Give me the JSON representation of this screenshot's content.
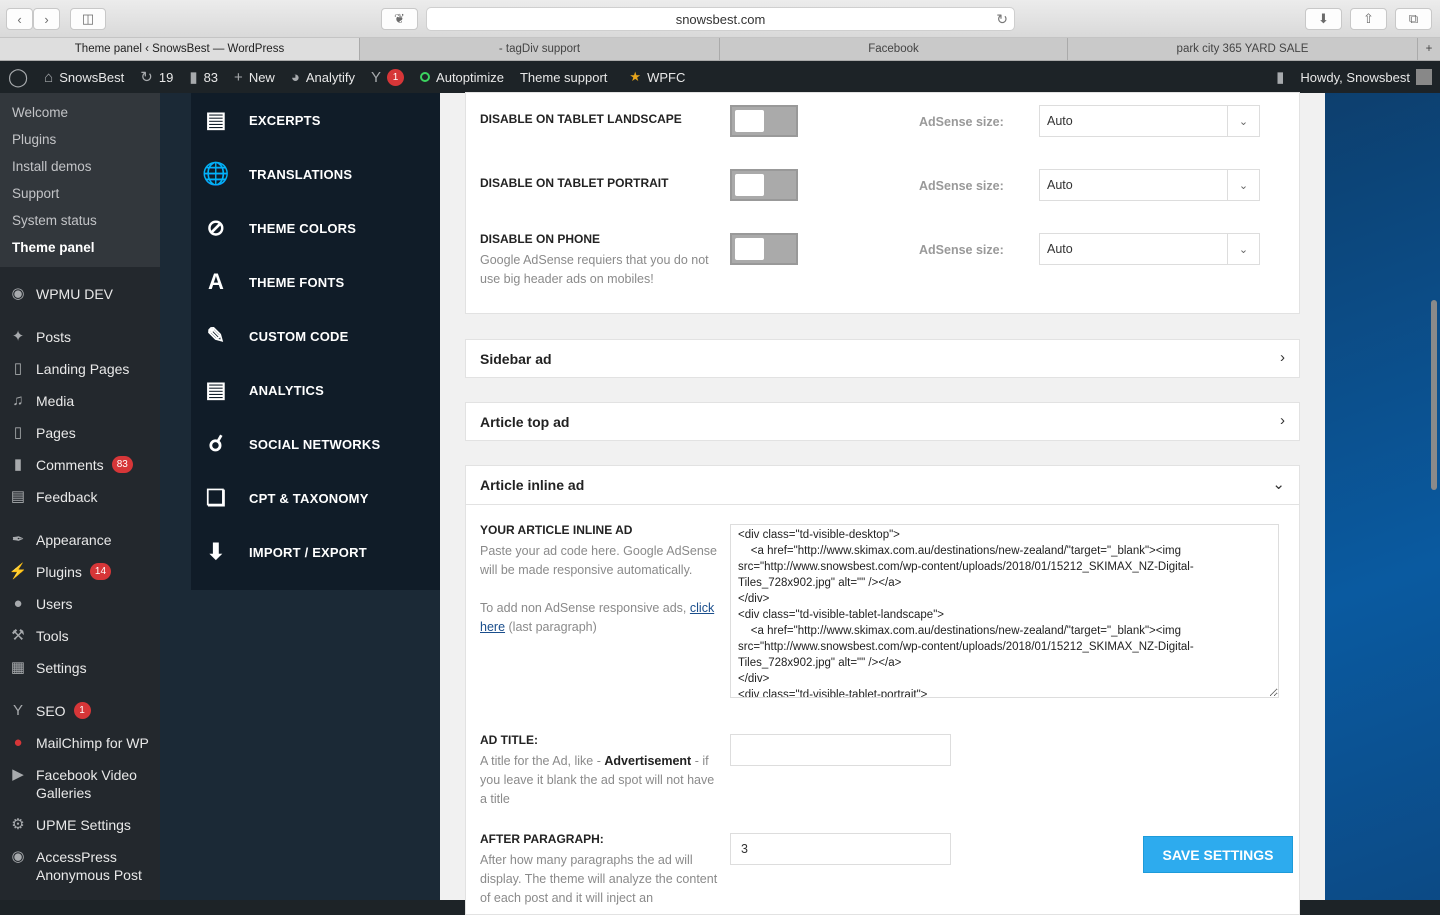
{
  "browser": {
    "url": "snowsbest.com",
    "tabs": [
      "Theme panel ‹ SnowsBest — WordPress",
      "- tagDiv support",
      "Facebook",
      "park city 365 YARD SALE"
    ]
  },
  "adminbar": {
    "site": "SnowsBest",
    "updates": "19",
    "comments": "83",
    "new": "New",
    "analytify": "Analytify",
    "seo_badge": "1",
    "autoptimize": "Autoptimize",
    "theme_support": "Theme support",
    "wpfc": "WPFC",
    "howdy": "Howdy, Snowsbest"
  },
  "wpmenu": {
    "submenu": [
      "Welcome",
      "Plugins",
      "Install demos",
      "Support",
      "System status",
      "Theme panel"
    ],
    "items": [
      {
        "label": "WPMU DEV",
        "icon": "wpmu-icon"
      },
      {
        "label": "Posts",
        "icon": "pin-icon"
      },
      {
        "label": "Landing Pages",
        "icon": "pages-icon"
      },
      {
        "label": "Media",
        "icon": "media-icon"
      },
      {
        "label": "Pages",
        "icon": "page-icon"
      },
      {
        "label": "Comments",
        "icon": "comment-icon",
        "badge": "83"
      },
      {
        "label": "Feedback",
        "icon": "feedback-icon"
      },
      {
        "label": "Appearance",
        "icon": "brush-icon"
      },
      {
        "label": "Plugins",
        "icon": "plug-icon",
        "badge": "14"
      },
      {
        "label": "Users",
        "icon": "user-icon"
      },
      {
        "label": "Tools",
        "icon": "wrench-icon"
      },
      {
        "label": "Settings",
        "icon": "settings-icon"
      },
      {
        "label": "SEO",
        "icon": "yoast-icon",
        "badge": "1"
      },
      {
        "label": "MailChimp for WP",
        "icon": "mailchimp-icon"
      },
      {
        "label": "Facebook Video Galleries",
        "icon": "video-icon"
      },
      {
        "label": "UPME Settings",
        "icon": "gear-icon"
      },
      {
        "label": "AccessPress Anonymous Post",
        "icon": "ap-icon"
      }
    ]
  },
  "tdnav": [
    "EXCERPTS",
    "TRANSLATIONS",
    "THEME COLORS",
    "THEME FONTS",
    "CUSTOM CODE",
    "ANALYTICS",
    "SOCIAL NETWORKS",
    "CPT & TAXONOMY",
    "IMPORT / EXPORT"
  ],
  "ads_rows": [
    {
      "label": "DISABLE ON TABLET LANDSCAPE",
      "size_label": "AdSense size:",
      "size": "Auto"
    },
    {
      "label": "DISABLE ON TABLET PORTRAIT",
      "size_label": "AdSense size:",
      "size": "Auto"
    },
    {
      "label": "DISABLE ON PHONE",
      "size_label": "AdSense size:",
      "size": "Auto",
      "desc": "Google AdSense requiers that you do not use big header ads on mobiles!"
    }
  ],
  "sections": {
    "sidebar": "Sidebar ad",
    "article_top": "Article top ad",
    "article_inline": "Article inline ad"
  },
  "inline": {
    "label": "YOUR ARTICLE INLINE AD",
    "desc": "Paste your ad code here. Google AdSense will be made responsive automatically.",
    "desc2": "To add non AdSense responsive ads,",
    "link": "click here",
    "desc2_after": "(last paragraph)",
    "code": "<div class=\"td-visible-desktop\">\n    <a href=\"http://www.skimax.com.au/destinations/new-zealand/\"target=\"_blank\"><img src=\"http://www.snowsbest.com/wp-content/uploads/2018/01/15212_SKIMAX_NZ-Digital-Tiles_728x902.jpg\" alt=\"\" /></a>\n</div>\n<div class=\"td-visible-tablet-landscape\">\n    <a href=\"http://www.skimax.com.au/destinations/new-zealand/\"target=\"_blank\"><img src=\"http://www.snowsbest.com/wp-content/uploads/2018/01/15212_SKIMAX_NZ-Digital-Tiles_728x902.jpg\" alt=\"\" /></a>\n</div>\n<div class=\"td-visible-tablet-portrait\">",
    "ad_title_label": "AD TITLE:",
    "ad_title_desc_pre": "A title for the Ad, like - ",
    "ad_title_desc_bold": "Advertisement",
    "ad_title_desc_post": " - if you leave it blank the ad spot will not have a title",
    "ad_title_value": "",
    "after_label": "AFTER PARAGRAPH:",
    "after_desc": "After how many paragraphs the ad will display. The theme will analyze the content of each post and it will inject an",
    "after_value": "3"
  },
  "save": "SAVE SETTINGS"
}
